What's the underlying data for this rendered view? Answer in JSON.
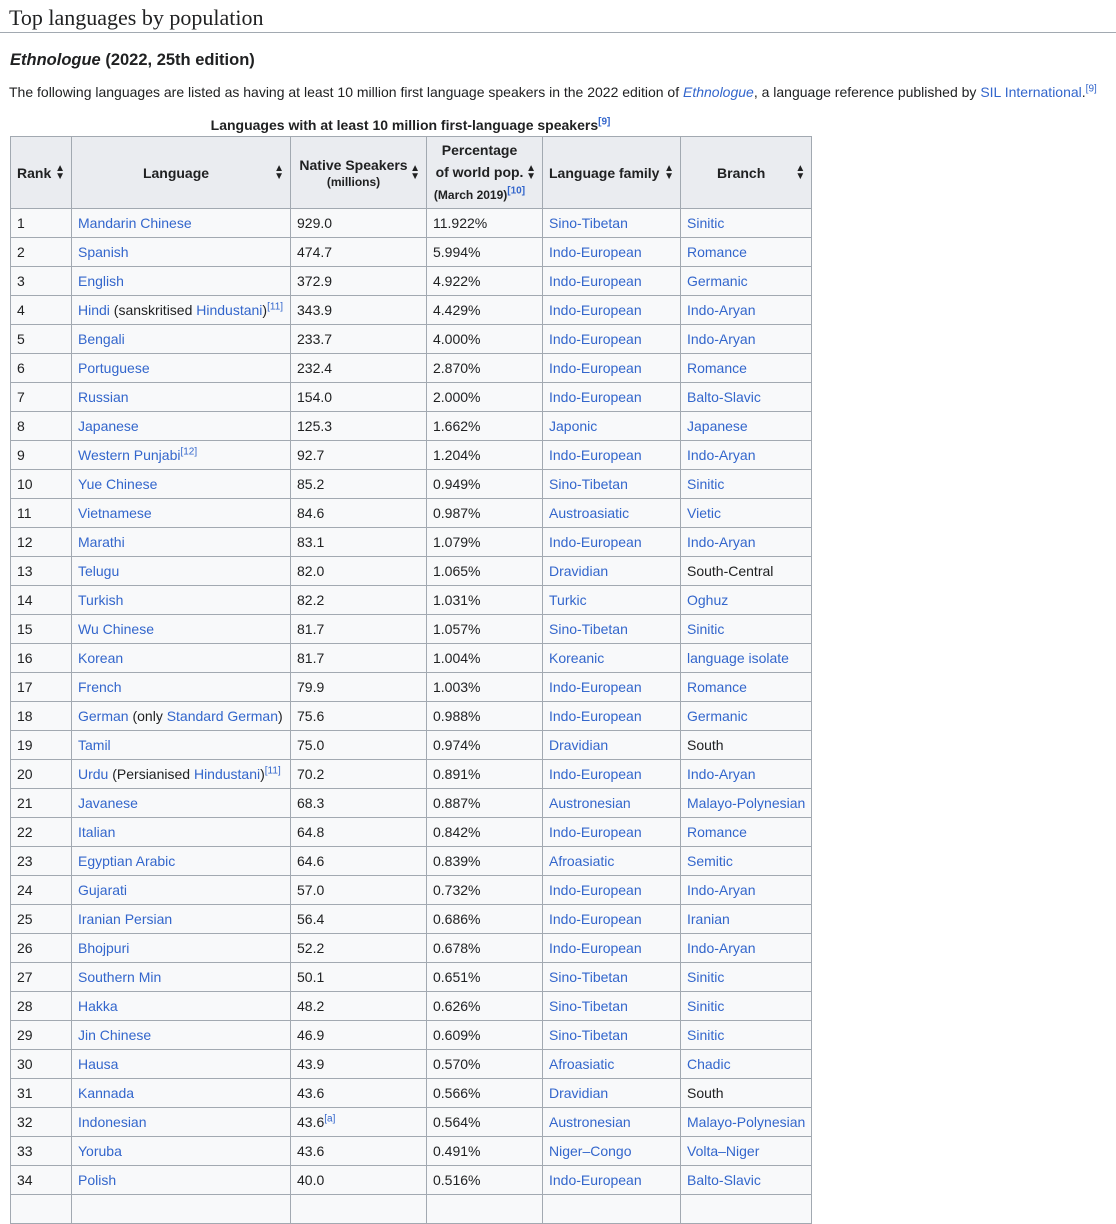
{
  "section_title": "Top languages by population",
  "subsection": {
    "italic": "Ethnologue",
    "rest": " (2022, 25th edition)"
  },
  "intro": {
    "t1": "The following languages are listed as having at least 10 million first language speakers in the 2022 edition of ",
    "link1": "Ethnologue",
    "t2": ", a language reference published by ",
    "link2": "SIL International",
    "t3": ".",
    "sup": "[9]"
  },
  "table": {
    "caption": "Languages with at least 10 million first-language speakers",
    "caption_sup": "[9]",
    "headers": {
      "rank": "Rank",
      "language": "Language",
      "native": "Native Speakers",
      "native_sub": "(millions)",
      "pct1": "Percentage",
      "pct2": "of world pop.",
      "pct_sub": "(March 2019)",
      "pct_sup": "[10]",
      "family": "Language family",
      "branch": "Branch"
    },
    "rows": [
      {
        "rank": "1",
        "lang": [
          [
            "Mandarin Chinese",
            1
          ]
        ],
        "speakers": "929.0",
        "pct": "11.922%",
        "family": "Sino-Tibetan",
        "branch": "Sinitic",
        "branch_link": true
      },
      {
        "rank": "2",
        "lang": [
          [
            "Spanish",
            1
          ]
        ],
        "speakers": "474.7",
        "pct": "5.994%",
        "family": "Indo-European",
        "branch": "Romance",
        "branch_link": true
      },
      {
        "rank": "3",
        "lang": [
          [
            "English",
            1
          ]
        ],
        "speakers": "372.9",
        "pct": "4.922%",
        "family": "Indo-European",
        "branch": "Germanic",
        "branch_link": true
      },
      {
        "rank": "4",
        "lang": [
          [
            "Hindi",
            1
          ],
          [
            " (sanskritised ",
            0
          ],
          [
            "Hindustani",
            1
          ],
          [
            ")",
            0
          ]
        ],
        "lang_sup": "[11]",
        "speakers": "343.9",
        "pct": "4.429%",
        "family": "Indo-European",
        "branch": "Indo-Aryan",
        "branch_link": true
      },
      {
        "rank": "5",
        "lang": [
          [
            "Bengali",
            1
          ]
        ],
        "speakers": "233.7",
        "pct": "4.000%",
        "family": "Indo-European",
        "branch": "Indo-Aryan",
        "branch_link": true
      },
      {
        "rank": "6",
        "lang": [
          [
            "Portuguese",
            1
          ]
        ],
        "speakers": "232.4",
        "pct": "2.870%",
        "family": "Indo-European",
        "branch": "Romance",
        "branch_link": true
      },
      {
        "rank": "7",
        "lang": [
          [
            "Russian",
            1
          ]
        ],
        "speakers": "154.0",
        "pct": "2.000%",
        "family": "Indo-European",
        "branch": "Balto-Slavic",
        "branch_link": true
      },
      {
        "rank": "8",
        "lang": [
          [
            "Japanese",
            1
          ]
        ],
        "speakers": "125.3",
        "pct": "1.662%",
        "family": "Japonic",
        "branch": "Japanese",
        "branch_link": true
      },
      {
        "rank": "9",
        "lang": [
          [
            "Western Punjabi",
            1
          ]
        ],
        "lang_sup": "[12]",
        "speakers": "92.7",
        "pct": "1.204%",
        "family": "Indo-European",
        "branch": "Indo-Aryan",
        "branch_link": true
      },
      {
        "rank": "10",
        "lang": [
          [
            "Yue Chinese",
            1
          ]
        ],
        "speakers": "85.2",
        "pct": "0.949%",
        "family": "Sino-Tibetan",
        "branch": "Sinitic",
        "branch_link": true
      },
      {
        "rank": "11",
        "lang": [
          [
            "Vietnamese",
            1
          ]
        ],
        "speakers": "84.6",
        "pct": "0.987%",
        "family": "Austroasiatic",
        "branch": "Vietic",
        "branch_link": true
      },
      {
        "rank": "12",
        "lang": [
          [
            "Marathi",
            1
          ]
        ],
        "speakers": "83.1",
        "pct": "1.079%",
        "family": "Indo-European",
        "branch": "Indo-Aryan",
        "branch_link": true
      },
      {
        "rank": "13",
        "lang": [
          [
            "Telugu",
            1
          ]
        ],
        "speakers": "82.0",
        "pct": "1.065%",
        "family": "Dravidian",
        "branch": "South-Central",
        "branch_link": false
      },
      {
        "rank": "14",
        "lang": [
          [
            "Turkish",
            1
          ]
        ],
        "speakers": "82.2",
        "pct": "1.031%",
        "family": "Turkic",
        "branch": "Oghuz",
        "branch_link": true
      },
      {
        "rank": "15",
        "lang": [
          [
            "Wu Chinese",
            1
          ]
        ],
        "speakers": "81.7",
        "pct": "1.057%",
        "family": "Sino-Tibetan",
        "branch": "Sinitic",
        "branch_link": true
      },
      {
        "rank": "16",
        "lang": [
          [
            "Korean",
            1
          ]
        ],
        "speakers": "81.7",
        "pct": "1.004%",
        "family": "Koreanic",
        "branch": "language isolate",
        "branch_link": true
      },
      {
        "rank": "17",
        "lang": [
          [
            "French",
            1
          ]
        ],
        "speakers": "79.9",
        "pct": "1.003%",
        "family": "Indo-European",
        "branch": "Romance",
        "branch_link": true
      },
      {
        "rank": "18",
        "lang": [
          [
            "German",
            1
          ],
          [
            " (only ",
            0
          ],
          [
            "Standard German",
            1
          ],
          [
            ")",
            0
          ]
        ],
        "speakers": "75.6",
        "pct": "0.988%",
        "family": "Indo-European",
        "branch": "Germanic",
        "branch_link": true
      },
      {
        "rank": "19",
        "lang": [
          [
            "Tamil",
            1
          ]
        ],
        "speakers": "75.0",
        "pct": "0.974%",
        "family": "Dravidian",
        "branch": "South",
        "branch_link": false
      },
      {
        "rank": "20",
        "lang": [
          [
            "Urdu",
            1
          ],
          [
            " (Persianised ",
            0
          ],
          [
            "Hindustani",
            1
          ],
          [
            ")",
            0
          ]
        ],
        "lang_sup": "[11]",
        "speakers": "70.2",
        "pct": "0.891%",
        "family": "Indo-European",
        "branch": "Indo-Aryan",
        "branch_link": true
      },
      {
        "rank": "21",
        "lang": [
          [
            "Javanese",
            1
          ]
        ],
        "speakers": "68.3",
        "pct": "0.887%",
        "family": "Austronesian",
        "branch": "Malayo-Polynesian",
        "branch_link": true
      },
      {
        "rank": "22",
        "lang": [
          [
            "Italian",
            1
          ]
        ],
        "speakers": "64.8",
        "pct": "0.842%",
        "family": "Indo-European",
        "branch": "Romance",
        "branch_link": true
      },
      {
        "rank": "23",
        "lang": [
          [
            "Egyptian Arabic",
            1
          ]
        ],
        "speakers": "64.6",
        "pct": "0.839%",
        "family": "Afroasiatic",
        "branch": "Semitic",
        "branch_link": true
      },
      {
        "rank": "24",
        "lang": [
          [
            "Gujarati",
            1
          ]
        ],
        "speakers": "57.0",
        "pct": "0.732%",
        "family": "Indo-European",
        "branch": "Indo-Aryan",
        "branch_link": true
      },
      {
        "rank": "25",
        "lang": [
          [
            "Iranian Persian",
            1
          ]
        ],
        "speakers": "56.4",
        "pct": "0.686%",
        "family": "Indo-European",
        "branch": "Iranian",
        "branch_link": true
      },
      {
        "rank": "26",
        "lang": [
          [
            "Bhojpuri",
            1
          ]
        ],
        "speakers": "52.2",
        "pct": "0.678%",
        "family": "Indo-European",
        "branch": "Indo-Aryan",
        "branch_link": true
      },
      {
        "rank": "27",
        "lang": [
          [
            "Southern Min",
            1
          ]
        ],
        "speakers": "50.1",
        "pct": "0.651%",
        "family": "Sino-Tibetan",
        "branch": "Sinitic",
        "branch_link": true
      },
      {
        "rank": "28",
        "lang": [
          [
            "Hakka",
            1
          ]
        ],
        "speakers": "48.2",
        "pct": "0.626%",
        "family": "Sino-Tibetan",
        "branch": "Sinitic",
        "branch_link": true
      },
      {
        "rank": "29",
        "lang": [
          [
            "Jin Chinese",
            1
          ]
        ],
        "speakers": "46.9",
        "pct": "0.609%",
        "family": "Sino-Tibetan",
        "branch": "Sinitic",
        "branch_link": true
      },
      {
        "rank": "30",
        "lang": [
          [
            "Hausa",
            1
          ]
        ],
        "speakers": "43.9",
        "pct": "0.570%",
        "family": "Afroasiatic",
        "branch": "Chadic",
        "branch_link": true
      },
      {
        "rank": "31",
        "lang": [
          [
            "Kannada",
            1
          ]
        ],
        "speakers": "43.6",
        "pct": "0.566%",
        "family": "Dravidian",
        "branch": "South",
        "branch_link": false
      },
      {
        "rank": "32",
        "lang": [
          [
            "Indonesian",
            1
          ]
        ],
        "speakers": "43.6",
        "speakers_sup": "[a]",
        "pct": "0.564%",
        "family": "Austronesian",
        "branch": "Malayo-Polynesian",
        "branch_link": true
      },
      {
        "rank": "33",
        "lang": [
          [
            "Yoruba",
            1
          ]
        ],
        "speakers": "43.6",
        "pct": "0.491%",
        "family": "Niger–Congo",
        "branch": "Volta–Niger",
        "branch_link": true
      },
      {
        "rank": "34",
        "lang": [
          [
            "Polish",
            1
          ]
        ],
        "speakers": "40.0",
        "pct": "0.516%",
        "family": "Indo-European",
        "branch": "Balto-Slavic",
        "branch_link": true
      }
    ]
  }
}
